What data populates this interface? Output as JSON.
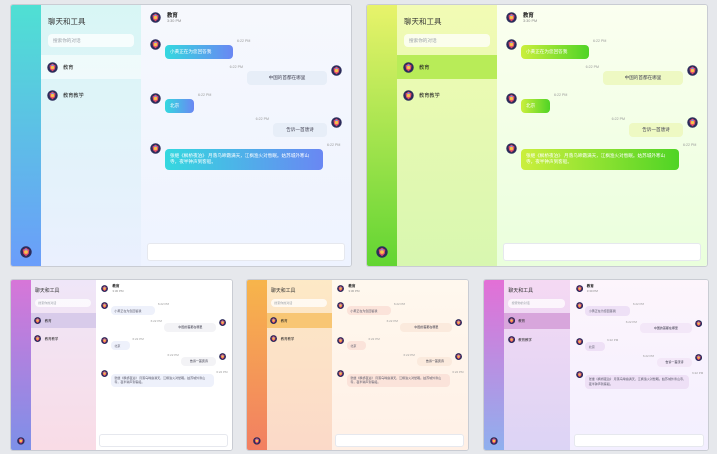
{
  "app": {
    "title": "聊天和工具",
    "search_placeholder": "搜索你的对话",
    "conversations": [
      {
        "label": "教育"
      },
      {
        "label": "教育教学"
      }
    ]
  },
  "chat": {
    "contact_name": "教育",
    "contact_time": "3:30 PM",
    "messages": [
      {
        "side": "left",
        "text": "小黄正在为您回答我",
        "time": "6:22 PM"
      },
      {
        "side": "right",
        "text": "中国的首都在哪里",
        "time": "6:22 PM"
      },
      {
        "side": "left",
        "text": "北京",
        "time": "6:22 PM"
      },
      {
        "side": "right",
        "text": "告诉一首唐诗",
        "time": "6:22 PM"
      },
      {
        "side": "left",
        "text": "张继《枫桥夜泊》 月落乌啼霜满天，江枫渔火对愁眠。姑苏城外寒山寺，夜半钟声到客船。",
        "time": "6:22 PM"
      }
    ]
  },
  "themes": [
    {
      "name": "teal-blue",
      "accent": "#4fe0d3"
    },
    {
      "name": "lime-green",
      "accent": "#b8ec58"
    },
    {
      "name": "purple-pink",
      "accent": "#d776d8"
    },
    {
      "name": "orange",
      "accent": "#f7b54b"
    },
    {
      "name": "magenta-violet",
      "accent": "#e36fd6"
    }
  ]
}
